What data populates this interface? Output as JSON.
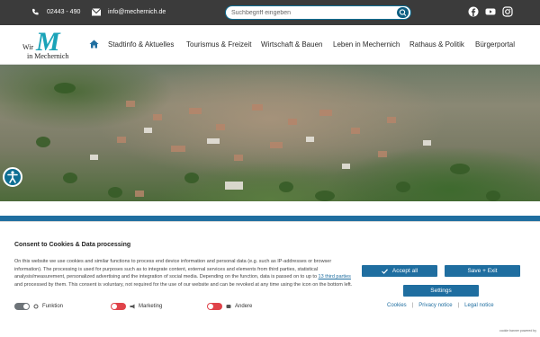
{
  "topbar": {
    "phone": "02443 - 490",
    "email": "info@mechernich.de",
    "search_placeholder": "Suchbegriff eingeben",
    "icons": [
      "phone-icon",
      "mail-icon",
      "search-icon",
      "facebook-icon",
      "youtube-icon",
      "instagram-icon"
    ]
  },
  "logo": {
    "wir": "Wir",
    "m": "M",
    "city": "in Mechernich"
  },
  "nav": {
    "items": [
      {
        "label": "Stadtinfo & Aktuelles"
      },
      {
        "label": "Tourismus & Freizeit"
      },
      {
        "label": "Wirtschaft & Bauen"
      },
      {
        "label": "Leben in Mechernich"
      },
      {
        "label": "Rathaus & Politik"
      },
      {
        "label": "Bürgerportal"
      }
    ]
  },
  "consent": {
    "title": "Consent to Cookies & Data processing",
    "text_before_link": "On this website we use cookies and similar functions to process end device information and personal data (e.g. such as IP-addresses or browser information). The processing is used for purposes such as to integrate content, external services and elements from third parties, statistical analysis/measurement, personalized advertising and the integration of social media. Depending on the function, data is passed on to up to ",
    "link_text": "13 third parties",
    "text_after_link": " and processed by them. This consent is voluntary, not required for the use of our website and can be revoked at any time using the icon on the bottom left.",
    "toggles": [
      {
        "label": "Funktion",
        "state": "on"
      },
      {
        "label": "Marketing",
        "state": "off"
      },
      {
        "label": "Andere",
        "state": "off"
      }
    ],
    "accept_label": "Accept all",
    "save_label": "Save + Exit",
    "settings_label": "Settings",
    "links": {
      "cookies": "Cookies",
      "privacy": "Privacy notice",
      "legal": "Legal notice"
    },
    "powered_by": "cookie banner powered by"
  },
  "colors": {
    "topbar": "#3b3b3b",
    "brand_blue": "#1f6ea0",
    "toggle_off": "#e0434a",
    "logo_teal": "#1aa3b8"
  }
}
